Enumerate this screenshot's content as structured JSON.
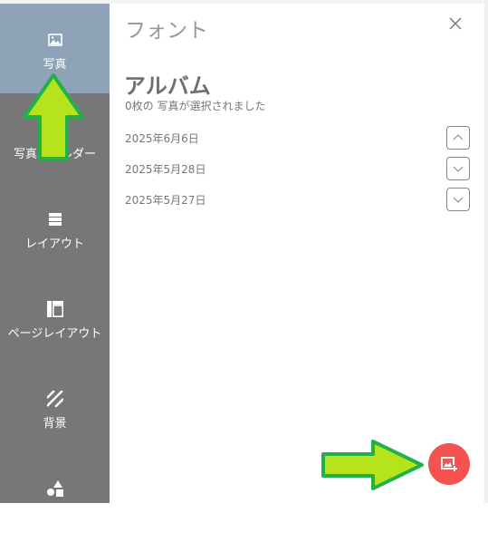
{
  "sidebar": {
    "items": [
      {
        "label": "写真",
        "icon": "image-icon",
        "active": true
      },
      {
        "label": "写真フォルダー",
        "icon": "folder-icon"
      },
      {
        "label": "レイアウト",
        "icon": "layout-icon"
      },
      {
        "label": "ページレイアウト",
        "icon": "page-layout-icon"
      },
      {
        "label": "背景",
        "icon": "background-icon"
      },
      {
        "label": "",
        "icon": "shapes-icon"
      }
    ]
  },
  "panel": {
    "title": "フォント",
    "album_title": "アルバム",
    "selection_status": "0枚の 写真が選択されました",
    "dates": [
      {
        "label": "2025年6月6日",
        "expanded": true
      },
      {
        "label": "2025年5月28日",
        "expanded": false
      },
      {
        "label": "2025年5月27日",
        "expanded": false
      }
    ]
  },
  "colors": {
    "sidebar": "#777777",
    "active": "#8fa3b8",
    "fab": "#f55252",
    "arrow_fill": "#b5e31c",
    "arrow_stroke": "#22b04a"
  }
}
